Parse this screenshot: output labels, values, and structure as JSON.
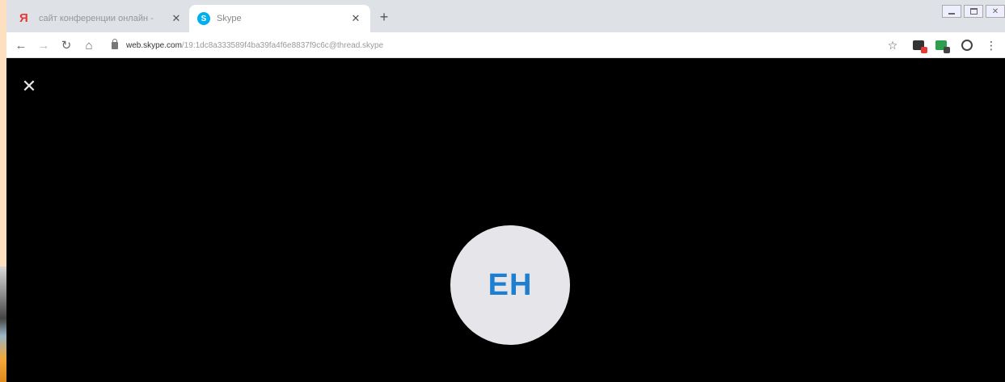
{
  "browser": {
    "tabs": [
      {
        "title": "сайт конференции онлайн -",
        "favicon": "yandex-icon",
        "active": false
      },
      {
        "title": "Skype",
        "favicon": "skype-icon",
        "active": true
      }
    ],
    "address": {
      "host": "web.skype.com",
      "path": "/19:1dc8a333589f4ba39fa4f6e8837f9c6c@thread.skype"
    }
  },
  "call": {
    "initials": "EH",
    "avatar_bg": "#e6e6ea",
    "initials_color": "#1e7fd1"
  }
}
